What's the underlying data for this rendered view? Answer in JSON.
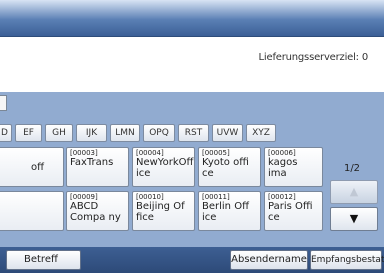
{
  "header": {
    "destination_label": "Lieferungsserverziel: 0"
  },
  "tabs": [
    "D",
    "EF",
    "GH",
    "IJK",
    "LMN",
    "OPQ",
    "RST",
    "UVW",
    "XYZ"
  ],
  "entries": [
    {
      "code": "",
      "name": "off"
    },
    {
      "code": "[00003]",
      "name": "FaxTrans"
    },
    {
      "code": "[00004]",
      "name": "NewYorkOff ice"
    },
    {
      "code": "[00005]",
      "name": "Kyoto offi ce"
    },
    {
      "code": "[00006]",
      "name": "kagos ima"
    },
    {
      "code": "",
      "name": ""
    },
    {
      "code": "[00009]",
      "name": "ABCD Compa ny"
    },
    {
      "code": "[00010]",
      "name": "Beijing Of fice"
    },
    {
      "code": "[00011]",
      "name": "Berlin Off ice"
    },
    {
      "code": "[00012]",
      "name": "Paris Offi ce"
    }
  ],
  "pager": {
    "page": "1/2",
    "up": "▲",
    "down": "▼"
  },
  "footer": {
    "subject": "Betreff",
    "sender_name": "Absendername",
    "receipt_confirm": "Empfangsbestat."
  }
}
